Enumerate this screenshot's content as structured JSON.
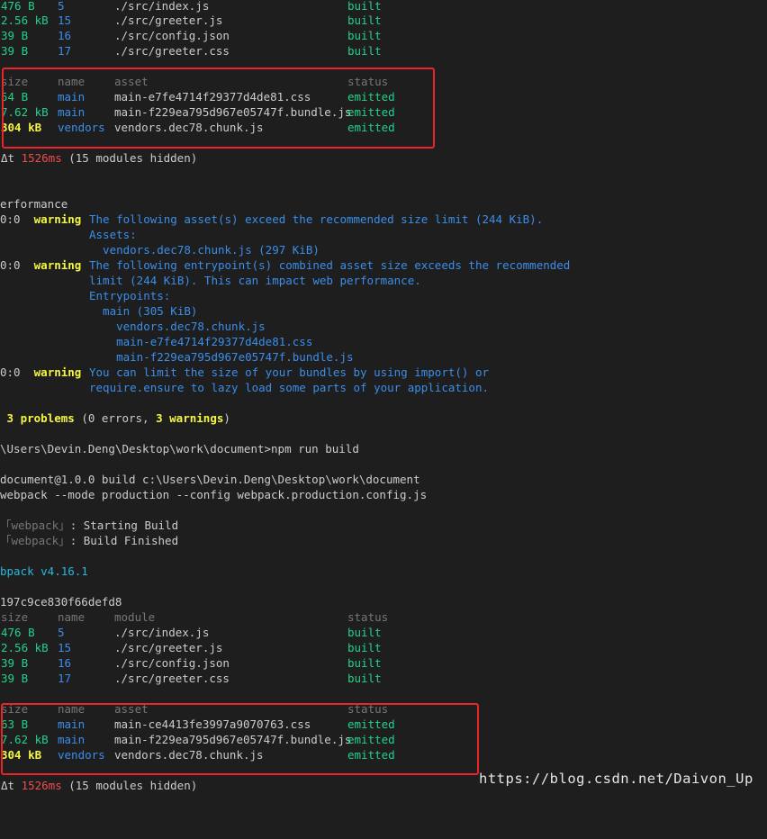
{
  "block1": {
    "rows": [
      {
        "size": "476 B",
        "name": "5",
        "module": "./src/index.js",
        "status": "built"
      },
      {
        "size": "2.56 kB",
        "name": "15",
        "module": "./src/greeter.js",
        "status": "built"
      },
      {
        "size": "39 B",
        "name": "16",
        "module": "./src/config.json",
        "status": "built"
      },
      {
        "size": "39 B",
        "name": "17",
        "module": "./src/greeter.css",
        "status": "built"
      }
    ]
  },
  "assets1": {
    "header": {
      "size": "size",
      "name": "name",
      "asset": "asset",
      "status": "status"
    },
    "rows": [
      {
        "size": "54 B",
        "name": "main",
        "asset": "main-e7fe4714f29377d4de81.css",
        "status": "emitted"
      },
      {
        "size": "7.62 kB",
        "name": "main",
        "asset": "main-f229ea795d967e05747f.bundle.js",
        "status": "emitted"
      },
      {
        "size": "304 kB",
        "name": "vendors",
        "asset": "vendors.dec78.chunk.js",
        "status": "emitted"
      }
    ],
    "time_prefix": "Δt ",
    "time": "1526ms",
    "hidden": " (15 modules hidden)"
  },
  "performance": {
    "title": "erformance",
    "warnings": [
      {
        "loc": "0:0 ",
        "label": "warning",
        "lines": [
          "The following asset(s) exceed the recommended size limit (244 KiB).",
          "Assets:",
          "  vendors.dec78.chunk.js (297 KiB)"
        ]
      },
      {
        "loc": "0:0 ",
        "label": "warning",
        "lines": [
          "The following entrypoint(s) combined asset size exceeds the recommended",
          "limit (244 KiB). This can impact web performance.",
          "Entrypoints:",
          "  main (305 KiB)",
          "    vendors.dec78.chunk.js",
          "    main-e7fe4714f29377d4de81.css",
          "    main-f229ea795d967e05747f.bundle.js"
        ]
      },
      {
        "loc": "0:0 ",
        "label": "warning",
        "lines": [
          "You can limit the size of your bundles by using import() or",
          "require.ensure to lazy load some parts of your application."
        ]
      }
    ],
    "problems_prefix": " ",
    "problems_count": "3 problems",
    "problems_mid": " (0 errors, ",
    "problems_warn": "3 warnings",
    "problems_end": ")"
  },
  "command": {
    "prompt": "\\Users\\Devin.Deng\\Desktop\\work\\document>npm run build",
    "script1": "document@1.0.0 build c:\\Users\\Devin.Deng\\Desktop\\work\\document",
    "script2": "webpack --mode production --config webpack.production.config.js",
    "log1_tag": "「webpack」",
    "log1_text": ": Starting Build",
    "log2_tag": "「webpack」",
    "log2_text": ": Build Finished",
    "version": "bpack v4.16.1",
    "hash": "197c9ce830f66defd8"
  },
  "block2": {
    "header": {
      "size": "size",
      "name": "name",
      "module": "module",
      "status": "status"
    },
    "rows": [
      {
        "size": "476 B",
        "name": "5",
        "module": "./src/index.js",
        "status": "built"
      },
      {
        "size": "2.56 kB",
        "name": "15",
        "module": "./src/greeter.js",
        "status": "built"
      },
      {
        "size": "39 B",
        "name": "16",
        "module": "./src/config.json",
        "status": "built"
      },
      {
        "size": "39 B",
        "name": "17",
        "module": "./src/greeter.css",
        "status": "built"
      }
    ]
  },
  "assets2": {
    "header": {
      "size": "size",
      "name": "name",
      "asset": "asset",
      "status": "status"
    },
    "rows": [
      {
        "size": "63 B",
        "name": "main",
        "asset": "main-ce4413fe3997a9070763.css",
        "status": "emitted"
      },
      {
        "size": "7.62 kB",
        "name": "main",
        "asset": "main-f229ea795d967e05747f.bundle.js",
        "status": "emitted"
      },
      {
        "size": "304 kB",
        "name": "vendors",
        "asset": "vendors.dec78.chunk.js",
        "status": "emitted"
      }
    ],
    "time_prefix": "Δt ",
    "time": "1526ms",
    "hidden": " (15 modules hidden)"
  },
  "watermark": "https://blog.csdn.net/Daivon_Up",
  "colors": {
    "background": "#1e1e1e",
    "size_green": "#23d18b",
    "name_blue": "#3b8eea",
    "warning_yellow": "#f5f543",
    "time_red": "#f14c4c",
    "highlight_box": "#e8262a"
  }
}
